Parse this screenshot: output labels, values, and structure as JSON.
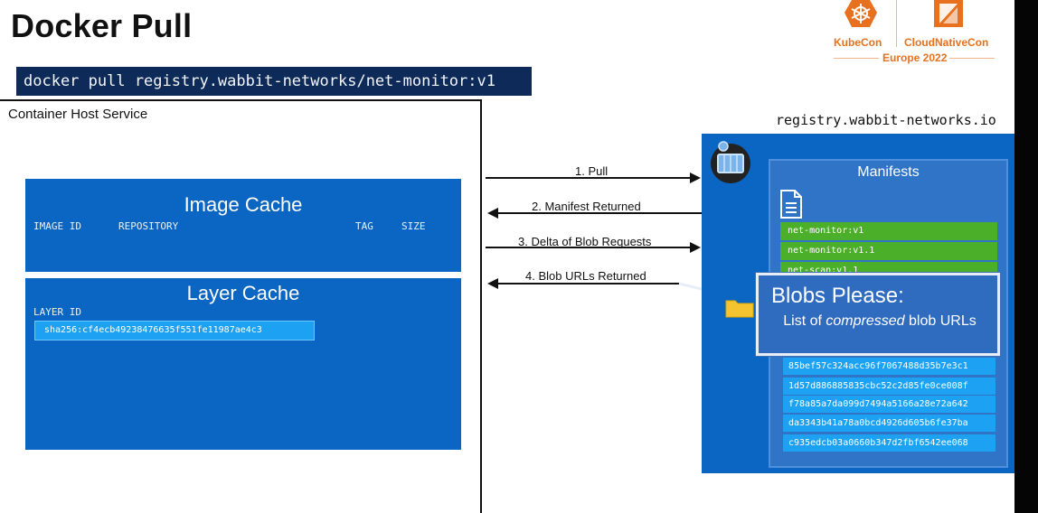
{
  "title": "Docker Pull",
  "command": "docker pull registry.wabbit-networks/net-monitor:v1",
  "logo": {
    "kubecon": "KubeCon",
    "cloudnativecon": "CloudNativeCon",
    "event": "Europe 2022",
    "kubecon_icon": "kubecon-helm-icon",
    "cncf_icon": "cncf-icon",
    "accent_color": "#e8711f"
  },
  "host": {
    "label": "Container Host Service",
    "image_cache": {
      "title": "Image Cache",
      "columns": [
        "IMAGE ID",
        "REPOSITORY",
        "TAG",
        "SIZE"
      ]
    },
    "layer_cache": {
      "title": "Layer Cache",
      "column": "LAYER ID",
      "rows": [
        "sha256:cf4ecb49238476635f551fe11987ae4c3"
      ]
    }
  },
  "arrows": [
    {
      "label": "1. Pull",
      "direction": "right"
    },
    {
      "label": "2. Manifest Returned",
      "direction": "left"
    },
    {
      "label": "3. Delta of Blob Requests",
      "direction": "right"
    },
    {
      "label": "4. Blob URLs Returned",
      "direction": "left"
    }
  ],
  "registry": {
    "label": "registry.wabbit-networks.io",
    "icon": "registry-icon",
    "manifests_title": "Manifests",
    "manifest_icon": "document-icon",
    "blob_icon": "folder-icon",
    "manifests": [
      "net-monitor:v1",
      "net-monitor:v1.1",
      "net-scan:v1.1"
    ],
    "blobs": [
      "85bef57c324acc96f7067488d35b7e3c1",
      "1d57d886885835cbc52c2d85fe0ce008f",
      "f78a85a7da099d7494a5166a28e72a642",
      "da3343b41a78a0bcd4926d605b6fe37ba",
      "c935edcb03a0660b347d2fbf6542ee068"
    ]
  },
  "callout": {
    "title": "Blobs Please:",
    "body_prefix": "List of ",
    "body_emphasis": "compressed",
    "body_suffix": " blob URLs"
  },
  "colors": {
    "panel_blue": "#0a66c2",
    "manifest_green": "#4caf2a",
    "blob_cyan": "#1da1f2",
    "command_bg": "#0e2a59"
  }
}
